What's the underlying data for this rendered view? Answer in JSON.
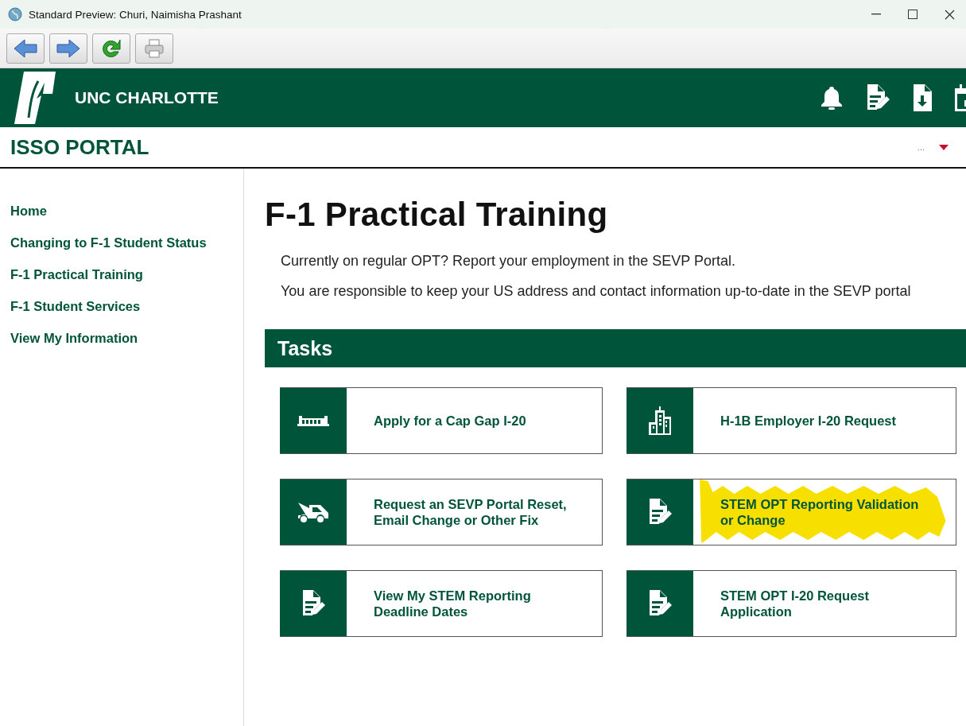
{
  "window": {
    "title": "Standard Preview: Churi, Naimisha Prashant"
  },
  "header": {
    "brand": "UNC CHARLOTTE",
    "portal_title": "ISSO PORTAL",
    "user_menu": "..."
  },
  "sidebar": {
    "items": [
      {
        "label": "Home"
      },
      {
        "label": "Changing to F-1 Student Status"
      },
      {
        "label": "F-1 Practical Training"
      },
      {
        "label": "F-1 Student Services"
      },
      {
        "label": "View My Information"
      }
    ]
  },
  "page": {
    "title": "F-1 Practical Training",
    "paragraphs": [
      "Currently on regular OPT? Report your employment in the SEVP Portal.",
      "You are responsible to keep your US address and contact information up-to-date in the SEVP portal"
    ]
  },
  "tasks": {
    "heading": "Tasks",
    "items": [
      {
        "label": "Apply for a Cap Gap I-20",
        "kind": "bridge",
        "highlighted": false
      },
      {
        "label": "H-1B Employer I-20 Request",
        "kind": "building",
        "highlighted": false
      },
      {
        "label": "Request an SEVP Portal Reset, Email Change or Other Fix",
        "kind": "truck",
        "highlighted": false
      },
      {
        "label": "STEM OPT Reporting Validation or Change",
        "kind": "document-edit",
        "highlighted": true
      },
      {
        "label": "View My STEM Reporting Deadline Dates",
        "kind": "document-edit",
        "highlighted": false
      },
      {
        "label": "STEM OPT I-20 Request Application",
        "kind": "document-edit",
        "highlighted": false
      }
    ]
  }
}
